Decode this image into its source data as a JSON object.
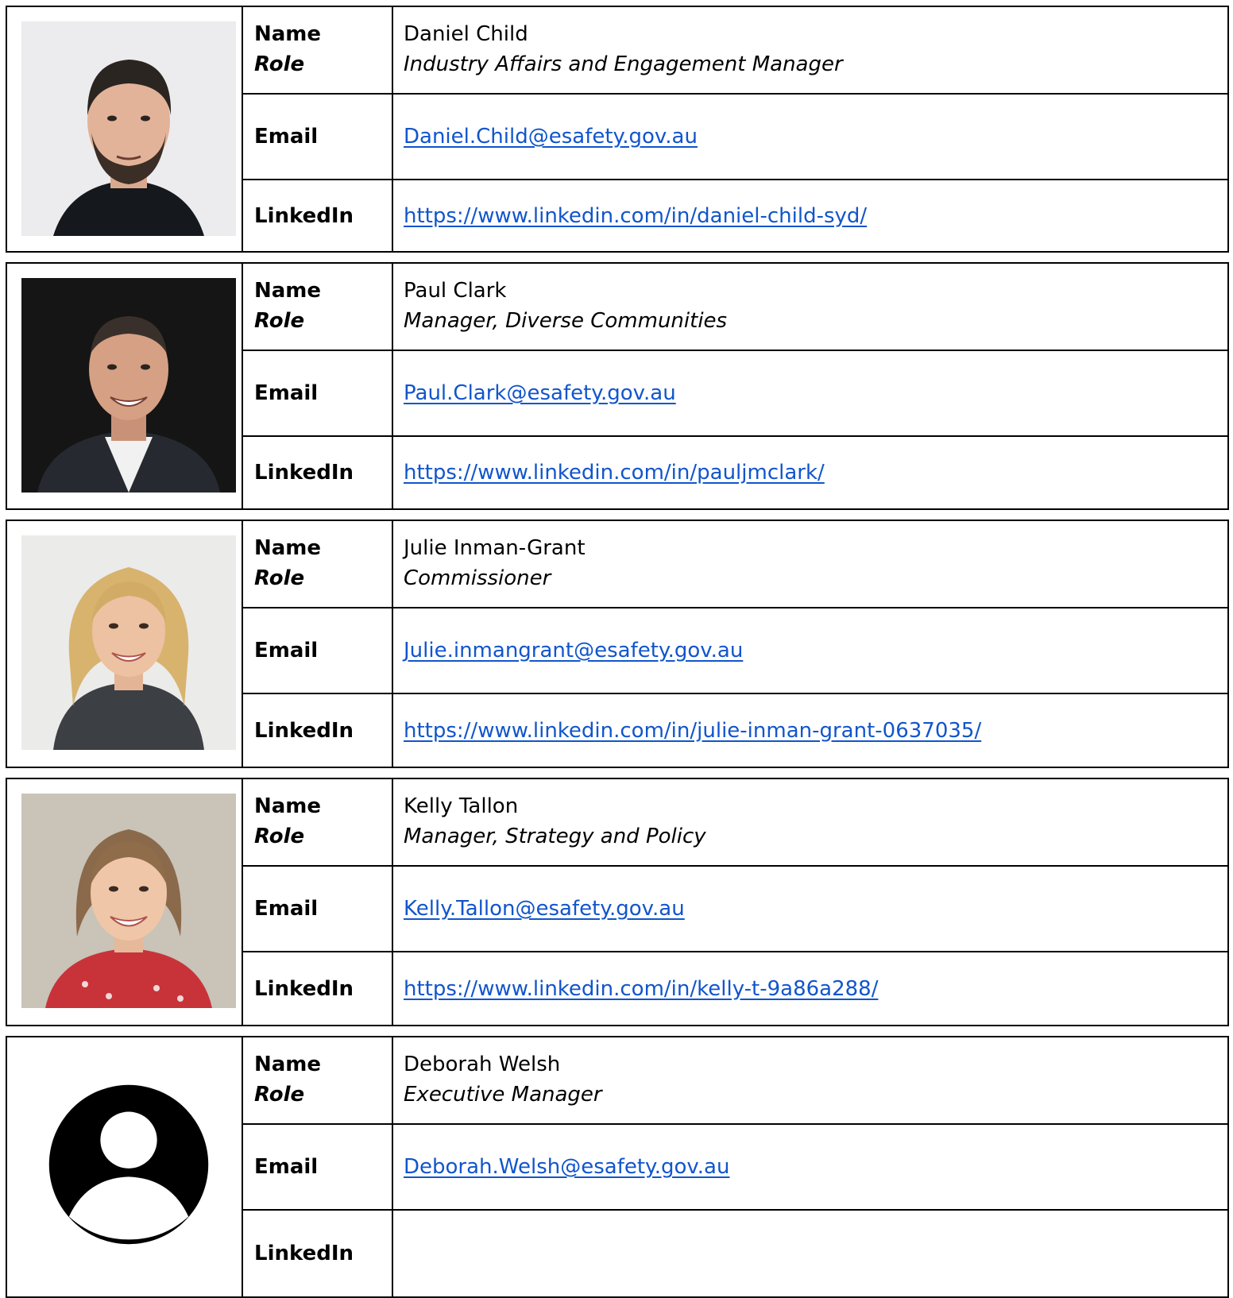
{
  "labels": {
    "name": "Name",
    "role": "Role",
    "email": "Email",
    "linkedin": "LinkedIn"
  },
  "contacts": [
    {
      "name": "Daniel Child",
      "role": "Industry Affairs and Engagement Manager",
      "email": "Daniel.Child@esafety.gov.au",
      "linkedin": "https://www.linkedin.com/in/daniel-child-syd/",
      "photo": "photo-man-beard"
    },
    {
      "name": "Paul Clark",
      "role": "Manager, Diverse Communities",
      "email": "Paul.Clark@esafety.gov.au",
      "linkedin": "https://www.linkedin.com/in/pauljmclark/",
      "photo": "photo-man-suit"
    },
    {
      "name": "Julie Inman-Grant",
      "role": "Commissioner",
      "email": "Julie.inmangrant@esafety.gov.au",
      "linkedin": "https://www.linkedin.com/in/julie-inman-grant-0637035/",
      "photo": "photo-woman-blonde"
    },
    {
      "name": "Kelly Tallon",
      "role": "Manager, Strategy and Policy",
      "email": "Kelly.Tallon@esafety.gov.au",
      "linkedin": "https://www.linkedin.com/in/kelly-t-9a86a288/",
      "photo": "photo-woman-smiling"
    },
    {
      "name": "Deborah Welsh",
      "role": "Executive Manager",
      "email": "Deborah.Welsh@esafety.gov.au",
      "linkedin": "",
      "photo": "user-placeholder-icon"
    }
  ]
}
